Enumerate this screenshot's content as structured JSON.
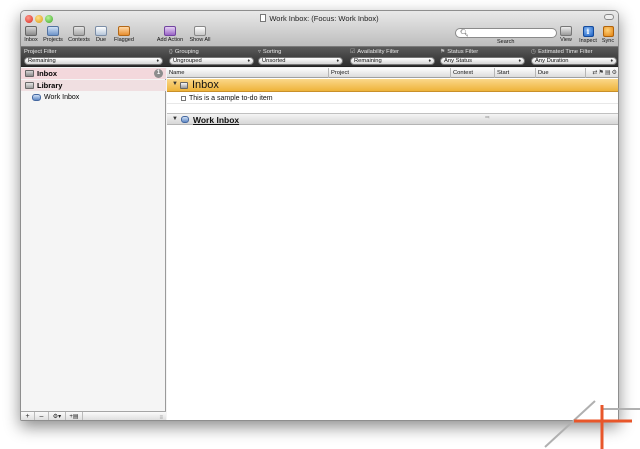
{
  "window": {
    "title": "Work Inbox:  (Focus: Work Inbox)"
  },
  "toolbar": {
    "items": [
      {
        "label": "Inbox",
        "icon": "inbox-icon"
      },
      {
        "label": "Projects",
        "icon": "projects-icon"
      },
      {
        "label": "Contexts",
        "icon": "contexts-icon"
      },
      {
        "label": "Due",
        "icon": "due-icon"
      },
      {
        "label": "Flagged",
        "icon": "flag-icon"
      },
      {
        "label": "Add Action",
        "icon": "add-action-icon"
      },
      {
        "label": "Show All",
        "icon": "show-all-icon"
      },
      {
        "label": "View",
        "icon": "view-icon"
      },
      {
        "label": "Inspect",
        "icon": "info-icon",
        "glyph": "i"
      },
      {
        "label": "Sync",
        "icon": "sync-icon"
      }
    ],
    "search": {
      "label": "Search",
      "placeholder": "",
      "value": ""
    }
  },
  "filters": {
    "project": {
      "label": "Project Filter",
      "value": "Remaining"
    },
    "grouping": {
      "label": "Grouping",
      "value": "Ungrouped"
    },
    "sorting": {
      "label": "Sorting",
      "value": "Unsorted"
    },
    "availability": {
      "label": "Availability Filter",
      "value": "Remaining"
    },
    "status": {
      "label": "Status Filter",
      "value": "Any Status"
    },
    "time": {
      "label": "Estimated Time Filter",
      "value": "Any Duration"
    }
  },
  "sidebar": {
    "inbox": {
      "label": "Inbox",
      "badge": "1"
    },
    "library": {
      "label": "Library"
    },
    "project": {
      "label": "Work Inbox"
    }
  },
  "outline": {
    "columns": [
      "Name",
      "Project",
      "Context",
      "Start",
      "Due"
    ],
    "inbox_group": "Inbox",
    "task": "This is a sample to-do item",
    "project_group": "Work Inbox"
  },
  "colors": {
    "accent_orange": "#eeb33a",
    "sidebar_selection": "#f3d8dc",
    "deco_orange": "#e8562a"
  }
}
